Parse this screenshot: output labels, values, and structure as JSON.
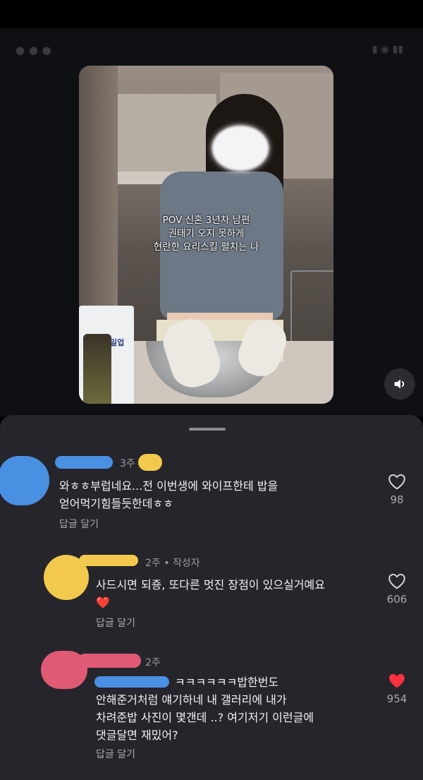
{
  "video": {
    "caption_lines": [
      "POV 신혼 3년차 남편",
      "권태기 오지 못하게",
      "현란한 요리스킬 펼치는 나"
    ],
    "bag_label": "일업",
    "sound_icon": "speaker-icon"
  },
  "comments": [
    {
      "time": "3주",
      "author_tag": "",
      "text_lines": [
        "와ㅎㅎ부럽네요...전 이번생에 와이프한테 밥을",
        "얻어먹기힘들듯한데ㅎㅎ"
      ],
      "reply_label": "답글 달기",
      "likes": "98",
      "liked": false
    },
    {
      "time": "2주",
      "author_tag": "작성자",
      "text_lines": [
        "사드시면 되죵, 또다른 멋진 장점이 있으실거예요"
      ],
      "emoji": "❤️",
      "reply_label": "답글 달기",
      "likes": "606",
      "liked": false
    },
    {
      "time": "2주",
      "author_tag": "",
      "text_lines": [
        "ㅋㅋㅋㅋㅋㅋ밥한번도",
        "안해준거처럼 얘기하네 내 갤러리에 내가",
        "차려준밥 사진이 몇갠데 ..? 여기저기 이런글에",
        "댓글달면 재밌어?"
      ],
      "reply_label": "답글 달기",
      "likes": "954",
      "liked": true
    }
  ],
  "colors": {
    "sheet_bg": "#25252b",
    "like_active": "#ff3040",
    "redact_blue": "#4a90e2",
    "redact_yellow": "#f2c94c",
    "redact_pink": "#e05a76"
  }
}
